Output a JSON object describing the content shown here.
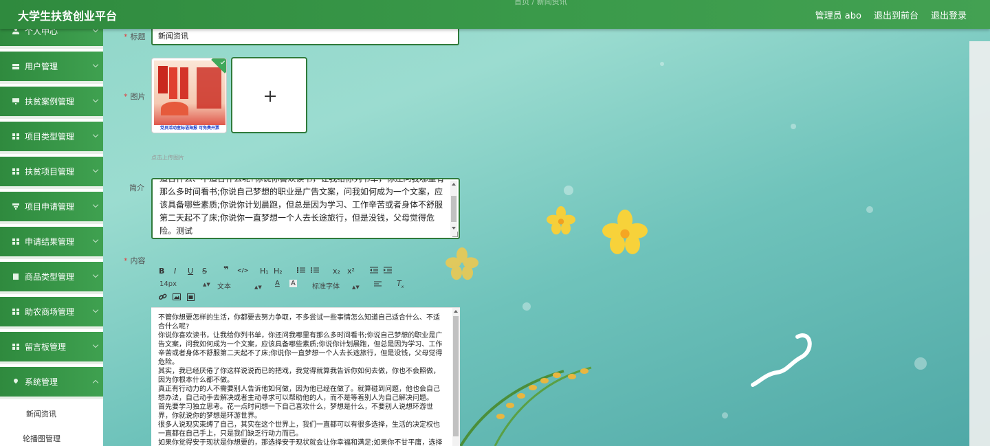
{
  "header": {
    "app_title": "大学生扶贫创业平台",
    "breadcrumb": "首页 / 新闻资讯",
    "admin_label": "管理员 abo",
    "exit_front": "退出到前台",
    "logout": "退出登录"
  },
  "sidebar": {
    "items": [
      {
        "label": "个人中心",
        "icon": "person-icon"
      },
      {
        "label": "用户管理",
        "icon": "users-icon"
      },
      {
        "label": "扶贫案例管理",
        "icon": "monitor-icon"
      },
      {
        "label": "项目类型管理",
        "icon": "grid-icon"
      },
      {
        "label": "扶贫项目管理",
        "icon": "grid-icon"
      },
      {
        "label": "项目申请管理",
        "icon": "filter-icon"
      },
      {
        "label": "申请结果管理",
        "icon": "grid-icon"
      },
      {
        "label": "商品类型管理",
        "icon": "doc-icon"
      },
      {
        "label": "助农商场管理",
        "icon": "grid-icon"
      },
      {
        "label": "留言板管理",
        "icon": "grid-icon"
      },
      {
        "label": "系统管理",
        "icon": "pin-icon"
      }
    ],
    "sub_items": [
      "新闻资讯",
      "轮播图管理"
    ]
  },
  "form": {
    "title_label": "标题",
    "title_value": "新闻资讯",
    "image_label": "图片",
    "poster_caption": "党员活动室标语海报  可免费开票",
    "upload_hint": "点击上传图片",
    "intro_label": "简介",
    "intro_text": "适合什么、不适合什么呢?你说你喜欢读书，让我给你列书单，你还问我哪里有那么多时间看书;你说自己梦想的职业是广告文案，问我如何成为一个文案，应该具备哪些素质;你说你计划晨跑，但总是因为学习、工作辛苦或者身体不舒服第二天起不了床;你说你一直梦想一个人去长途旅行，但是没钱，父母觉得危险。测试",
    "content_label": "内容"
  },
  "editor": {
    "toolbar_row1": [
      "B",
      "I",
      "U",
      "S",
      "❞",
      "</>",
      "H₁",
      "H₂",
      "list-ol",
      "list-ul",
      "x₂",
      "x²",
      "outdent",
      "indent"
    ],
    "font_size": "14px",
    "text_type": "文本",
    "font_family": "标准字体",
    "content": [
      "不管你想要怎样的生活，你都要去努力争取，不多尝试一些事情怎么知道自己适合什么、不适合什么呢?",
      "你说你喜欢读书，让我给你列书单，你还问我哪里有那么多时间看书;你说自己梦想的职业是广告文案，问我如何成为一个文案，应该具备哪些素质;你说你计划晨跑，但总是因为学习、工作辛苦或者身体不舒服第二天起不了床;你说你一直梦想一个人去长途旅行，但是没钱，父母觉得危险。",
      "其实，我已经厌倦了你这样说说而已的把戏，我觉得就算我告诉你如何去做，你也不会照做，因为你根本什么都不做。",
      "真正有行动力的人不需要别人告诉他如何做，因为他已经在做了。就算碰到问题，他也会自己想办法，自己动手去解决或者主动寻求可以帮助他的人，而不是等着别人为自己解决问题。",
      "首先要学习独立思考。花一点时间想一下自己喜欢什么，梦想是什么，不要别人说想环游世界，你就说你的梦想是环游世界。",
      "很多人说现实束缚了自己，其实在这个世界上，我们一直都可以有很多选择，生活的决定权也一直都在自己手上，只是我们缺乏行动力而已。",
      "如果你觉得安于现状是你想要的，那选择安于现状就会让你幸福和满足;如果你不甘平庸，选择一条改变、进取和奋斗的道路，在这个追求的过程中，你也一样会感到快乐。所谓的成功，即是按"
    ]
  },
  "colors": {
    "header_green": "#2f8a3e",
    "menu_green": "#3fa150",
    "required_red": "#e04040",
    "input_border": "#2f7a3a"
  }
}
